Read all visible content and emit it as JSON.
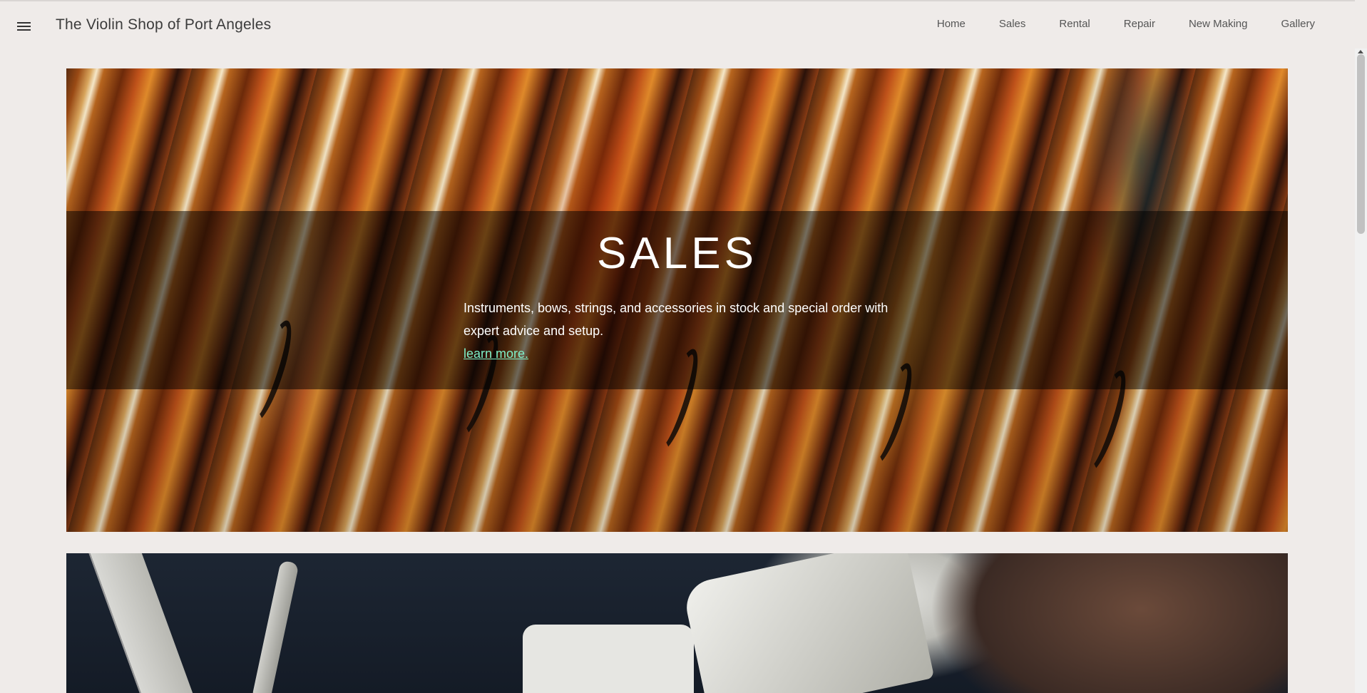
{
  "header": {
    "site_title": "The Violin Shop of Port Angeles",
    "nav": [
      "Home",
      "Sales",
      "Rental",
      "Repair",
      "New Making",
      "Gallery"
    ]
  },
  "hero_sales": {
    "title": "SALES",
    "description": "Instruments, bows, strings, and accessories in stock and special order with expert advice and setup.",
    "link": "learn more."
  },
  "colors": {
    "page_background": "#efebe9",
    "link": "#7ff0c8",
    "overlay": "rgba(0,0,0,0.5)"
  },
  "icons": {
    "menu": "hamburger-menu-icon"
  }
}
